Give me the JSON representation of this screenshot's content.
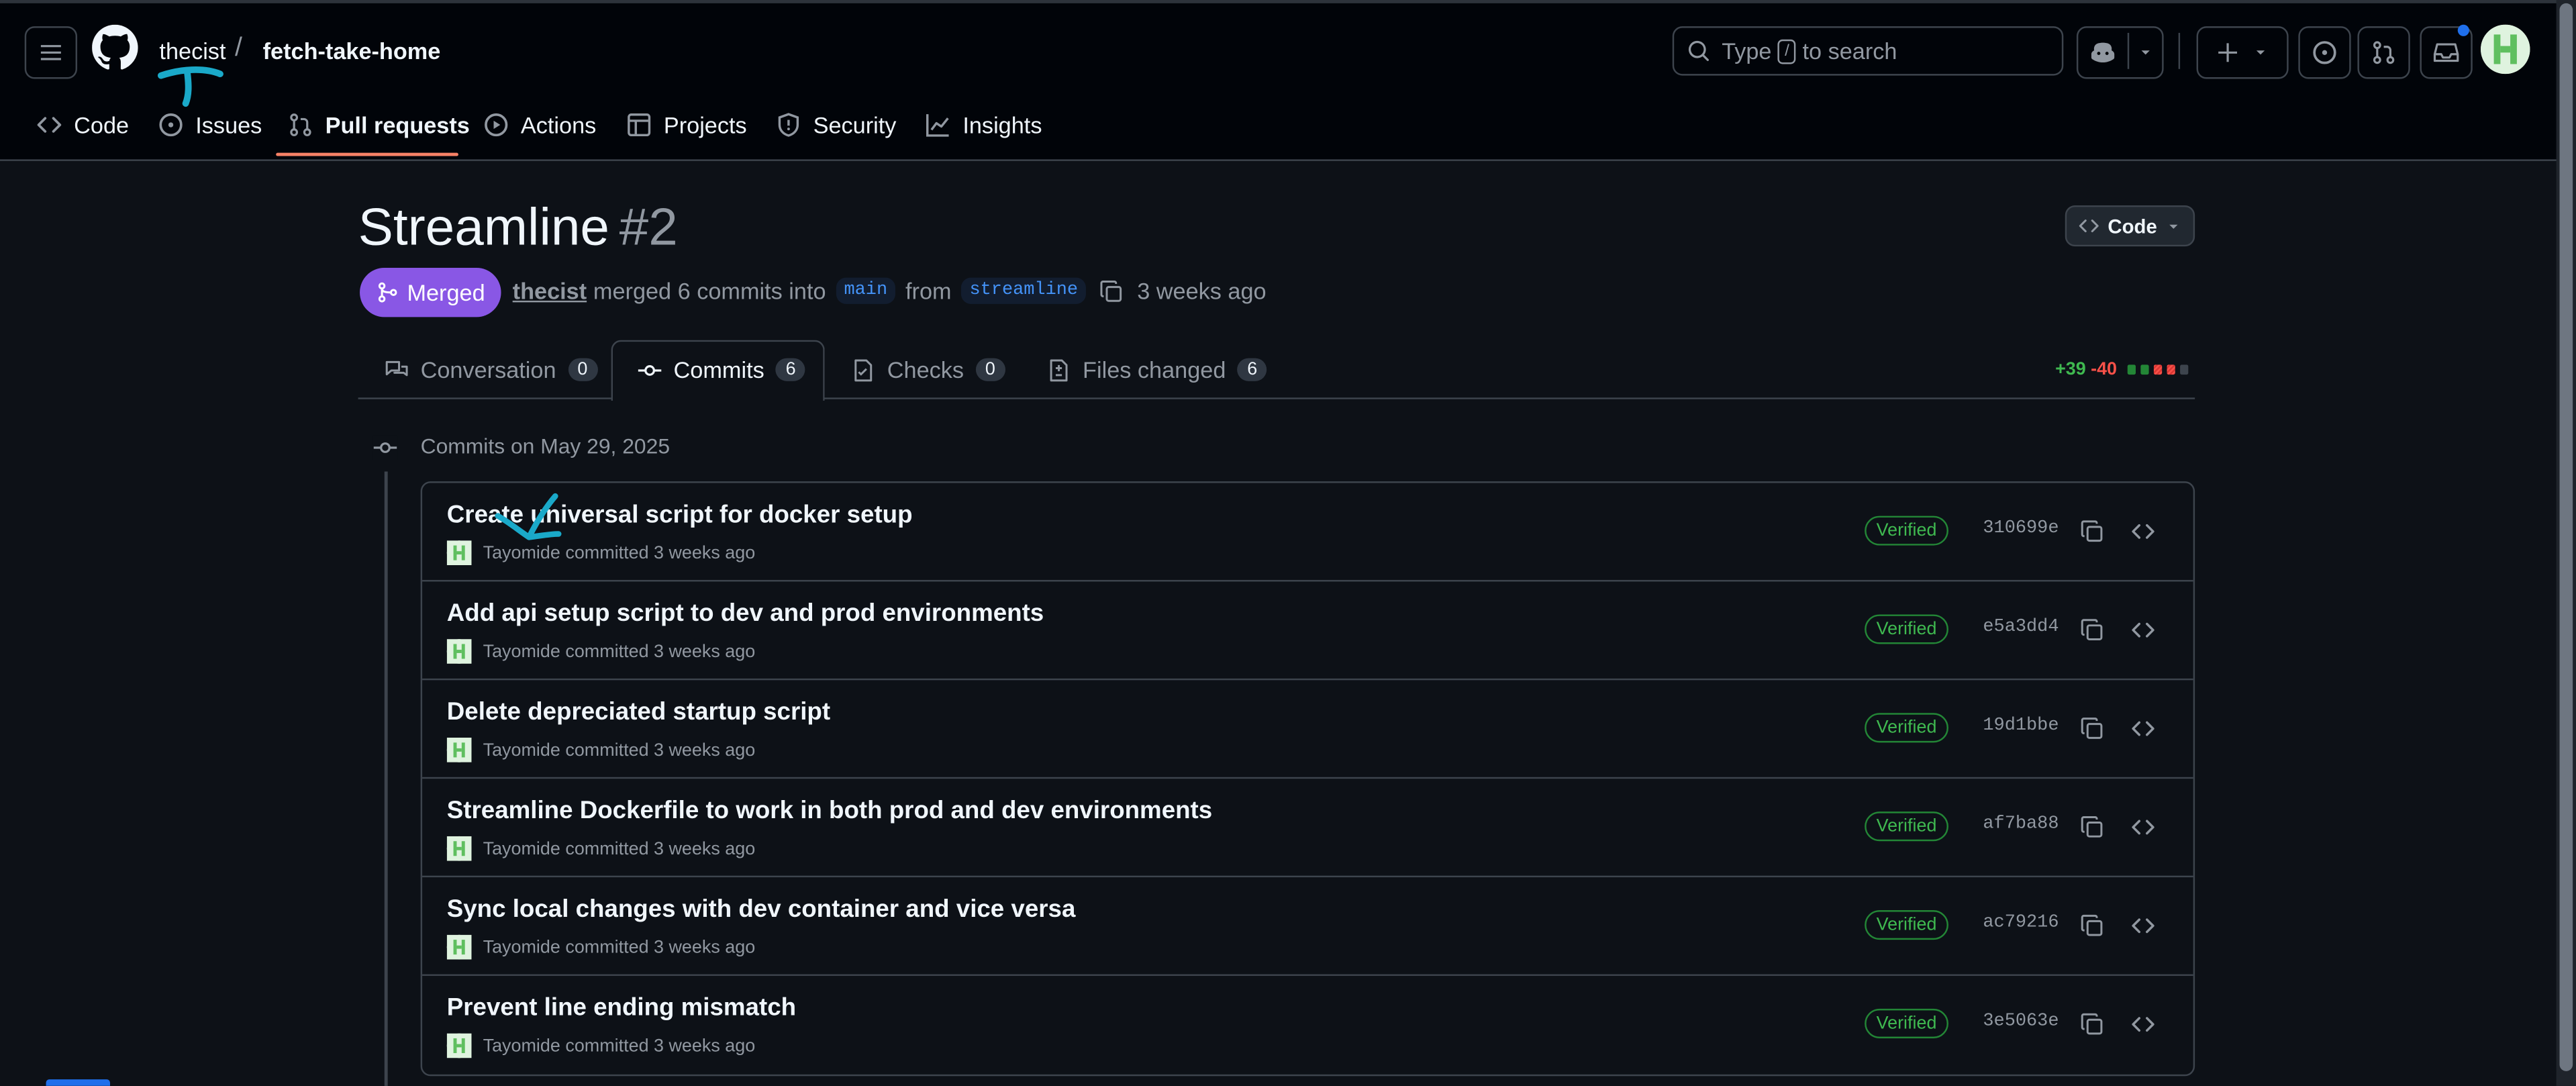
{
  "header": {
    "owner": "thecist",
    "separator": "/",
    "repo": "fetch-take-home",
    "search_prefix": "Type",
    "search_key": "/",
    "search_suffix": "to search",
    "nav": [
      {
        "label": "Code",
        "icon": "code-icon"
      },
      {
        "label": "Issues",
        "icon": "issue-opened-icon"
      },
      {
        "label": "Pull requests",
        "icon": "git-pull-request-icon"
      },
      {
        "label": "Actions",
        "icon": "play-icon"
      },
      {
        "label": "Projects",
        "icon": "table-icon"
      },
      {
        "label": "Security",
        "icon": "shield-icon"
      },
      {
        "label": "Insights",
        "icon": "graph-icon"
      }
    ]
  },
  "pr": {
    "title": "Streamline",
    "number": "#2",
    "code_button": "Code",
    "state": "Merged",
    "author": "thecist",
    "merged_text": "merged 6 commits into",
    "base_branch": "main",
    "from_text": "from",
    "head_branch": "streamline",
    "time": "3 weeks ago"
  },
  "tabs": [
    {
      "label": "Conversation",
      "count": "0"
    },
    {
      "label": "Commits",
      "count": "6"
    },
    {
      "label": "Checks",
      "count": "0"
    },
    {
      "label": "Files changed",
      "count": "6"
    }
  ],
  "diffstat": {
    "additions": "+39",
    "deletions": "-40"
  },
  "commits_heading": "Commits on May 29, 2025",
  "commits": [
    {
      "message": "Create universal script for docker setup",
      "author": "Tayomide",
      "action": "committed 3 weeks ago",
      "verified": "Verified",
      "sha": "310699e"
    },
    {
      "message": "Add api setup script to dev and prod environments",
      "author": "Tayomide",
      "action": "committed 3 weeks ago",
      "verified": "Verified",
      "sha": "e5a3dd4"
    },
    {
      "message": "Delete depreciated startup script",
      "author": "Tayomide",
      "action": "committed 3 weeks ago",
      "verified": "Verified",
      "sha": "19d1bbe"
    },
    {
      "message": "Streamline Dockerfile to work in both prod and dev environments",
      "author": "Tayomide",
      "action": "committed 3 weeks ago",
      "verified": "Verified",
      "sha": "af7ba88"
    },
    {
      "message": "Sync local changes with dev container and vice versa",
      "author": "Tayomide",
      "action": "committed 3 weeks ago",
      "verified": "Verified",
      "sha": "ac79216"
    },
    {
      "message": "Prevent line ending mismatch",
      "author": "Tayomide",
      "action": "committed 3 weeks ago",
      "verified": "Verified",
      "sha": "3e5063e"
    }
  ],
  "colors": {
    "background": "#0d1117",
    "header_background": "#010409",
    "merged_purple": "#8957e5",
    "accent_orange": "#f78166",
    "verified_green": "#3fb950",
    "annotation_cyan": "#1aa9c9"
  }
}
